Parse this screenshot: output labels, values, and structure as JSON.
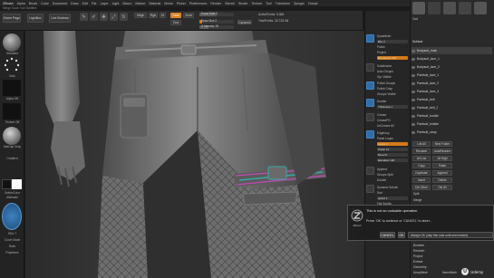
{
  "menubar": {
    "app": "ZBrush",
    "items": [
      "Alpha",
      "Brush",
      "Color",
      "Document",
      "Draw",
      "Edit",
      "File",
      "Layer",
      "Light",
      "Macro",
      "Marker",
      "Material",
      "Movie",
      "Picker",
      "Preferences",
      "Render",
      "Stencil",
      "Stroke",
      "Texture",
      "Tool",
      "Transform",
      "Zplugin",
      "Zscript"
    ],
    "subtitle": "Merge Down Vue Subtitles"
  },
  "toolbar": {
    "home_page": "Home Page",
    "lightbox": "LightBox",
    "live_boolean": "Live Boolean",
    "edit": "Edit",
    "draw": "Draw",
    "move": "Move",
    "scale": "Scale",
    "rotate": "Rotate",
    "mrgb": "Mrgb",
    "rgb": "Rgb",
    "m": "M",
    "zadd": "Zadd",
    "zsub": "Zsub",
    "zcut": "Zcut",
    "focal_shift": "Focal Shift 0",
    "draw_size": "Draw Size 2",
    "dynamic": "Dynamic",
    "z_intensity": "Z Intensity 25",
    "active_points": "ActivePoints: 5,088",
    "total_points": "TotalPoints: 26.728 Mil"
  },
  "left_shelf": {
    "brush_label": "Standard",
    "stroke_label": "Dots",
    "alpha_label": "Alpha Off",
    "texture_label": "Texture Off",
    "material_label": "MatCap Gray",
    "gradient_label": "Gradient",
    "switch_color": "SwitchColor",
    "alternate": "Alternate",
    "subdiv_label": "SDiv 7",
    "curve_mode": "Curve Mode",
    "ruler_label": "Ruler",
    "polyframe": "Polyframe",
    "accent": "#2f6ea8"
  },
  "mid_panel": {
    "dynamesh_label": "DynaMesh",
    "blur_label": "Blur 2",
    "polish_label": "Polish",
    "project_label": "Project",
    "resolution": "Resolution 128",
    "subdiv_label": "Subdivision",
    "auto_groups": "Auto Groups",
    "grp_vis": "Grp Visible",
    "polish_groups": "Polish Groups",
    "polish_crisp": "Polish Crisp",
    "group_visible": "Groups Visible",
    "double": "Double",
    "thickness": "Thickness 1",
    "crease": "Crease",
    "creasepg": "CreasePG",
    "uncrease": "UnCrease All",
    "edgeloop": "Edgeloop",
    "panel_loops": "Panel Loops",
    "loops": "Loops 4",
    "polish": "Polish 10",
    "bevel": "Bevel 0",
    "elevation": "Elevation 100",
    "append": "Append",
    "groups_split": "Groups Split",
    "double2": "Double",
    "dynamic_sub": "Dynamic Subdiv",
    "smt": "Smt",
    "qgrid": "QGrid 1",
    "flat_subdiv": "Flat Subdiv"
  },
  "right_panel": {
    "tool_label": "Tool",
    "subtool_header": "Subtool",
    "subtools": [
      "Bodysuit_main",
      "Bodysuit_lace_1",
      "Bodysuit_lace_2",
      "Pantsuit_lace_1",
      "Pantsuit_lace_2",
      "Pantsuit_lace_3",
      "Pantsuit_belt",
      "Pantsuit_belt_2",
      "Pantsuit_buckle",
      "Pantsuit_holster",
      "Pantsuit_strap"
    ],
    "list_all": "List All",
    "new_folder": "New Folder",
    "rename": "Rename",
    "auto_reorder": "AutoReorder",
    "all_low": "All Low",
    "all_high": "All High",
    "copy": "Copy",
    "paste": "Paste",
    "duplicate": "Duplicate",
    "append": "Append",
    "insert": "Insert",
    "delete": "Delete",
    "del_other": "Del Other",
    "del_all": "Del All",
    "split": "Split",
    "merge": "Merge",
    "boolean": "Boolean",
    "remesh": "Remesh",
    "project": "Project",
    "extract": "Extract",
    "geometry": "Geometry",
    "arraymesh": "ArrayMesh",
    "nanomesh": "NanoMesh"
  },
  "dialog": {
    "line1": "This is not an undoable operation.",
    "line2": "Press 'OK' to continue or 'CANCEL' to abort...",
    "logo_text": "ZBrush",
    "cancel": "CANCEL",
    "ok": "OK",
    "always_ok": "Always OK (skip this note until next restart)"
  },
  "udemy": {
    "text": "Udemy"
  }
}
